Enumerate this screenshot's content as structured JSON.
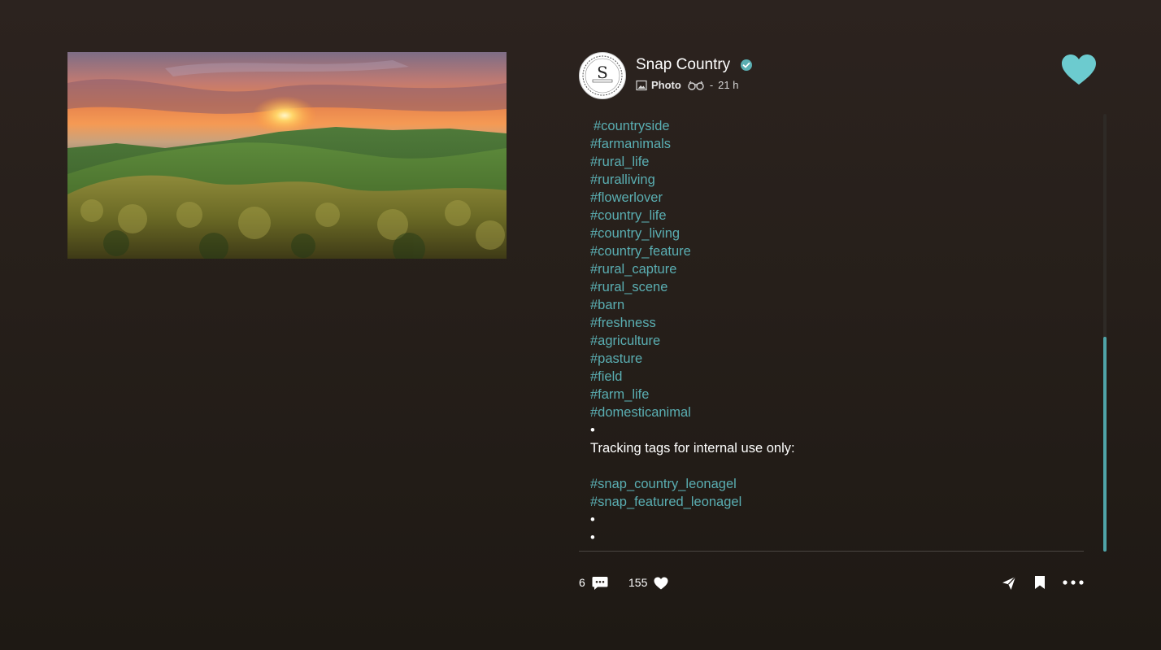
{
  "post": {
    "author": "Snap Country",
    "type": "Photo",
    "time": "21 h",
    "separator": "-",
    "avatar_text": "S"
  },
  "caption": {
    "lines": [
      {
        "text": "#countryside",
        "kind": "tag"
      },
      {
        "text": "#farmanimals",
        "kind": "tag"
      },
      {
        "text": "#rural_life",
        "kind": "tag"
      },
      {
        "text": "#ruralliving",
        "kind": "tag"
      },
      {
        "text": "#flowerlover",
        "kind": "tag"
      },
      {
        "text": "#country_life",
        "kind": "tag"
      },
      {
        "text": "#country_living",
        "kind": "tag"
      },
      {
        "text": "#country_feature",
        "kind": "tag"
      },
      {
        "text": "#rural_capture",
        "kind": "tag"
      },
      {
        "text": "#rural_scene",
        "kind": "tag"
      },
      {
        "text": "#barn",
        "kind": "tag"
      },
      {
        "text": "#freshness",
        "kind": "tag"
      },
      {
        "text": "#agriculture",
        "kind": "tag"
      },
      {
        "text": "#pasture",
        "kind": "tag"
      },
      {
        "text": "#field",
        "kind": "tag"
      },
      {
        "text": "#farm_life",
        "kind": "tag"
      },
      {
        "text": "#domesticanimal",
        "kind": "tag"
      },
      {
        "text": "•",
        "kind": "plain"
      },
      {
        "text": "Tracking tags for internal use only:",
        "kind": "plain"
      },
      {
        "text": "",
        "kind": "plain"
      },
      {
        "text": "#snap_country_leonagel",
        "kind": "tag"
      },
      {
        "text": "#snap_featured_leonagel",
        "kind": "tag"
      },
      {
        "text": "•",
        "kind": "plain"
      },
      {
        "text": "•",
        "kind": "plain"
      }
    ]
  },
  "actions": {
    "comments_count": "6",
    "likes_count": "155"
  },
  "icons": {
    "verified": "verified-badge-icon",
    "photo_type": "image-icon",
    "audience": "binoculars-icon",
    "favorite": "heart-icon",
    "comment": "comment-icon",
    "like": "heart-icon",
    "share": "send-icon",
    "save": "bookmark-icon",
    "more": "more-horizontal-icon"
  },
  "colors": {
    "accent": "#5aaeb2",
    "favorite": "#6ccbcf",
    "background": "#261f1a"
  }
}
